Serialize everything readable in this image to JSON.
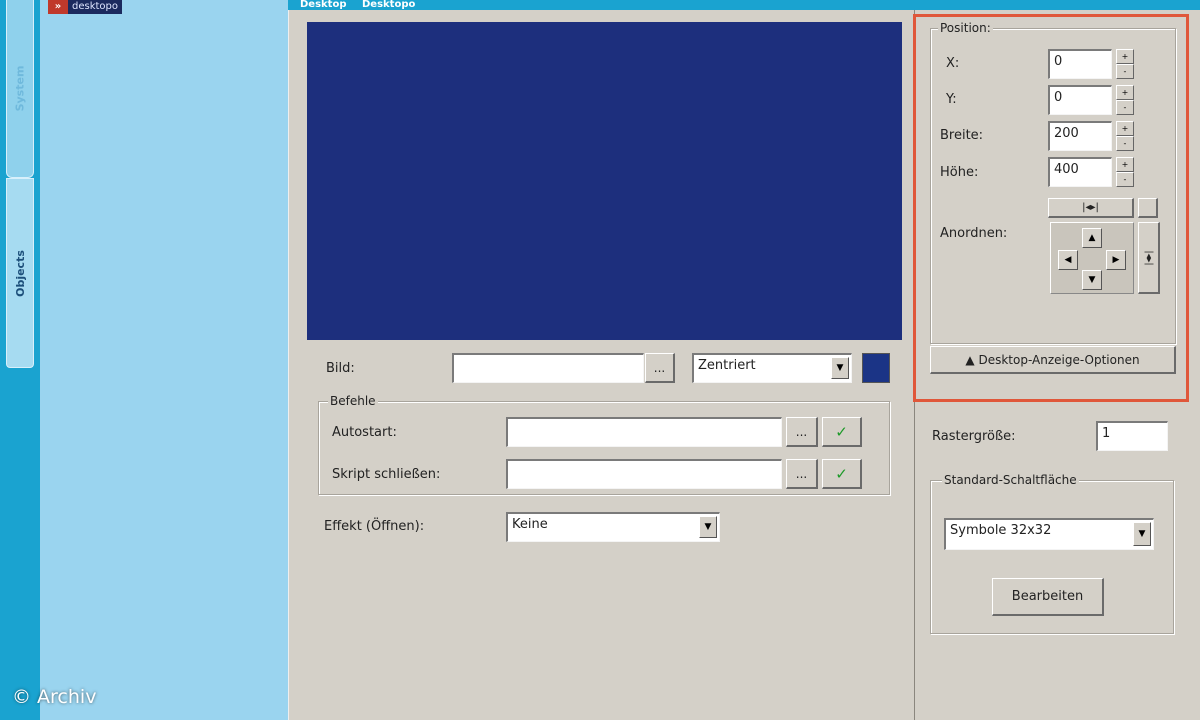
{
  "app": {
    "logo_mark": "»",
    "logo_text": "desktopo",
    "header_tabs": [
      "Desktop",
      "Desktopo"
    ],
    "copyright": "© Archiv"
  },
  "sidebar": {
    "tabs": [
      {
        "label": "System"
      },
      {
        "label": "Objects"
      }
    ]
  },
  "main": {
    "preview_color": "#1d2f7d",
    "bild": {
      "label": "Bild:",
      "value": "",
      "browse_label": "...",
      "mode_value": "Zentriert",
      "color_swatch": "#1b3486"
    },
    "befehle": {
      "group_label": "Befehle",
      "autostart_label": "Autostart:",
      "autostart_value": "",
      "skript_label": "Skript schließen:",
      "skript_value": "",
      "browse_label": "...",
      "run_icon": "check-arrow-icon"
    },
    "effekt": {
      "label": "Effekt (Öffnen):",
      "value": "Keine"
    }
  },
  "position": {
    "group_label": "Position:",
    "x_label": "X:",
    "x_value": "0",
    "y_label": "Y:",
    "y_value": "0",
    "breite_label": "Breite:",
    "breite_value": "200",
    "hoehe_label": "Höhe:",
    "hoehe_value": "400",
    "anordnen_label": "Anordnen:",
    "spin_up": "+",
    "spin_down": "-",
    "stretch_h": "|◂▸|",
    "stretch_v": "|◂▸|",
    "arrow_up": "▲",
    "arrow_down": "▼",
    "arrow_left": "◀",
    "arrow_right": "▶",
    "options_button": "▲ Desktop-Anzeige-Optionen"
  },
  "raster": {
    "label": "Rastergröße:",
    "value": "1"
  },
  "standard": {
    "group_label": "Standard-Schaltfläche",
    "select_value": "Symbole 32x32",
    "edit_button": "Bearbeiten"
  },
  "colors": {
    "accent": "#1aa3d0",
    "tree_bg": "#9ad4ef",
    "highlight": "#e0573a",
    "panel": "#d4d0c8"
  }
}
